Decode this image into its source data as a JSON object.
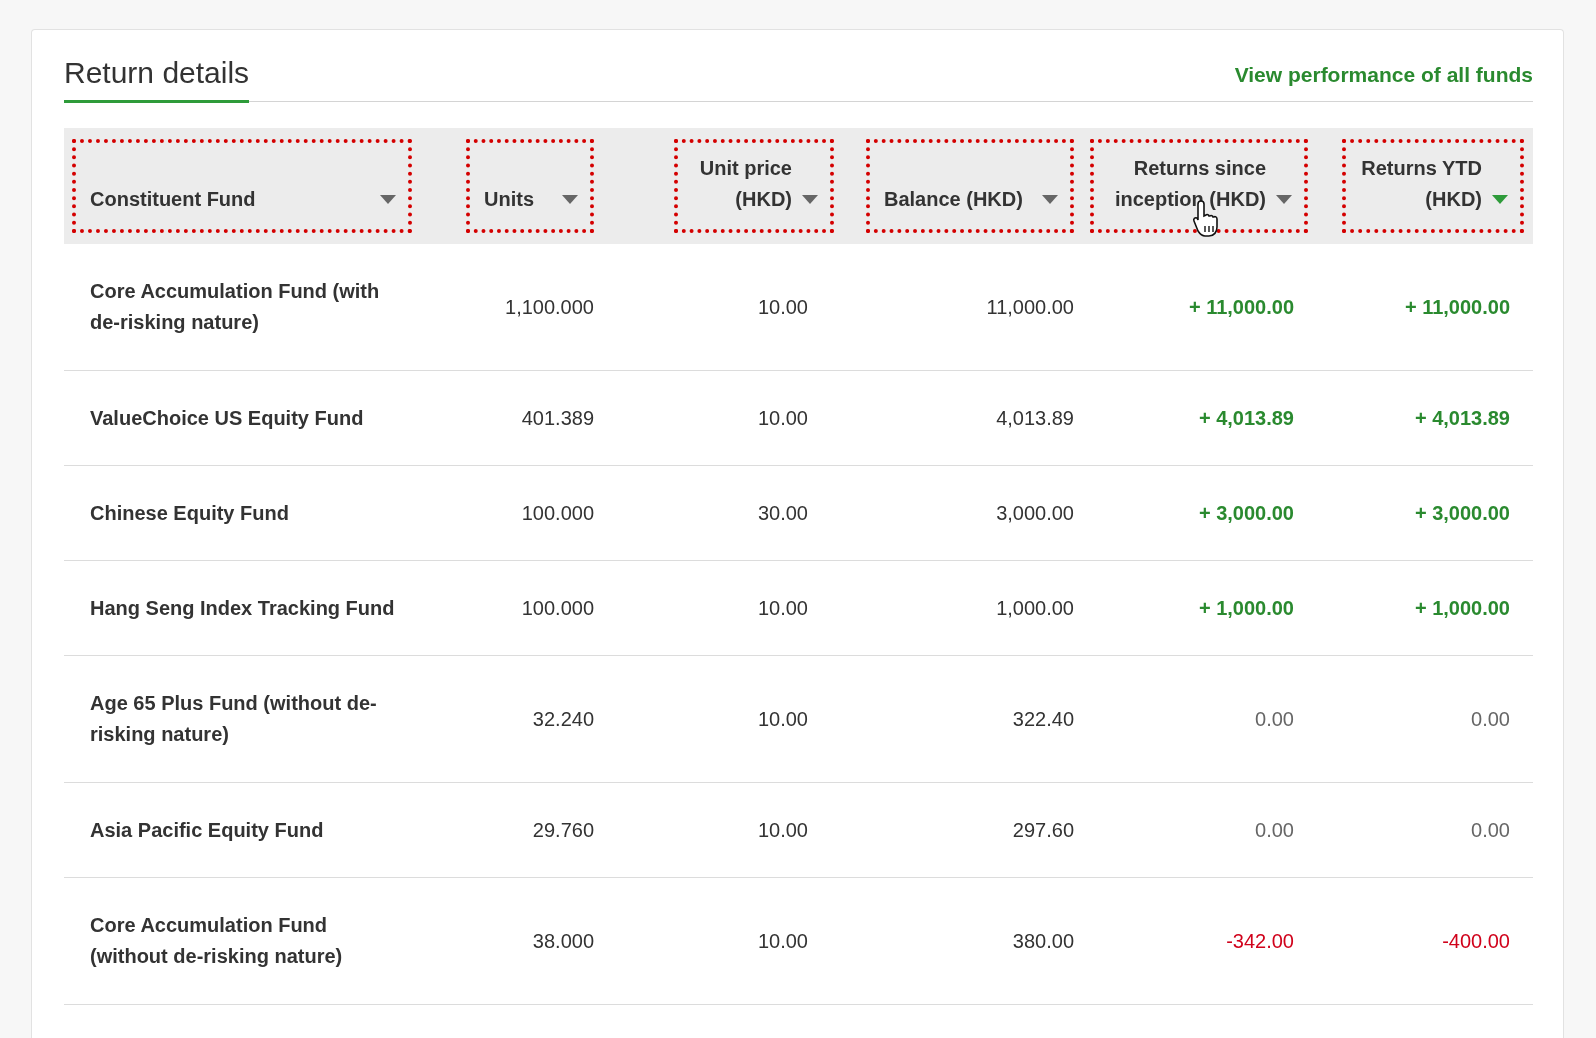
{
  "section": {
    "title": "Return details",
    "link": "View performance of all funds"
  },
  "table": {
    "columns": [
      {
        "label": "Constituent Fund",
        "sorted": false
      },
      {
        "label": "Units",
        "sorted": false
      },
      {
        "label": "Unit price (HKD)",
        "sorted": false
      },
      {
        "label": "Balance (HKD)",
        "sorted": false
      },
      {
        "label": "Returns since inception (HKD)",
        "sorted": false
      },
      {
        "label": "Returns YTD (HKD)",
        "sorted": true
      }
    ],
    "rows": [
      {
        "fund": "Core Accumulation Fund (with de-risking nature)",
        "units": "1,100.000",
        "unit_price": "10.00",
        "balance": "11,000.00",
        "returns_since_inception": {
          "text": "+ 11,000.00",
          "kind": "gain"
        },
        "returns_ytd": {
          "text": "+ 11,000.00",
          "kind": "gain"
        }
      },
      {
        "fund": "ValueChoice US Equity Fund",
        "units": "401.389",
        "unit_price": "10.00",
        "balance": "4,013.89",
        "returns_since_inception": {
          "text": "+ 4,013.89",
          "kind": "gain"
        },
        "returns_ytd": {
          "text": "+ 4,013.89",
          "kind": "gain"
        }
      },
      {
        "fund": "Chinese Equity Fund",
        "units": "100.000",
        "unit_price": "30.00",
        "balance": "3,000.00",
        "returns_since_inception": {
          "text": "+ 3,000.00",
          "kind": "gain"
        },
        "returns_ytd": {
          "text": "+ 3,000.00",
          "kind": "gain"
        }
      },
      {
        "fund": "Hang Seng Index Tracking Fund",
        "units": "100.000",
        "unit_price": "10.00",
        "balance": "1,000.00",
        "returns_since_inception": {
          "text": "+ 1,000.00",
          "kind": "gain"
        },
        "returns_ytd": {
          "text": "+ 1,000.00",
          "kind": "gain"
        }
      },
      {
        "fund": "Age 65 Plus Fund (without de-risking nature)",
        "units": "32.240",
        "unit_price": "10.00",
        "balance": "322.40",
        "returns_since_inception": {
          "text": "0.00",
          "kind": "zero"
        },
        "returns_ytd": {
          "text": "0.00",
          "kind": "zero"
        }
      },
      {
        "fund": "Asia Pacific Equity Fund",
        "units": "29.760",
        "unit_price": "10.00",
        "balance": "297.60",
        "returns_since_inception": {
          "text": "0.00",
          "kind": "zero"
        },
        "returns_ytd": {
          "text": "0.00",
          "kind": "zero"
        }
      },
      {
        "fund": "Core Accumulation Fund (without de-risking nature)",
        "units": "38.000",
        "unit_price": "10.00",
        "balance": "380.00",
        "returns_since_inception": {
          "text": "-342.00",
          "kind": "loss"
        },
        "returns_ytd": {
          "text": "-400.00",
          "kind": "loss"
        }
      }
    ]
  }
}
